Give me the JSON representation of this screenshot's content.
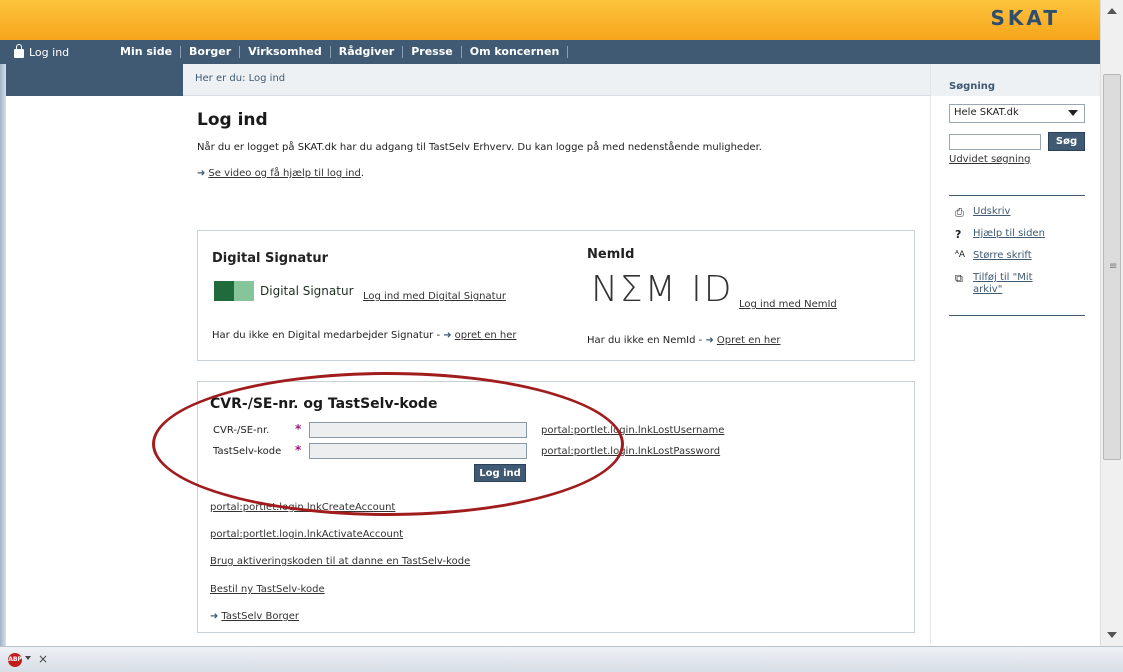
{
  "brand": {
    "logo": "SKAT",
    "accent": "#f7a51c",
    "nav_color": "#3f5a72",
    "highlight_circle": "#a11c1c"
  },
  "nav": {
    "login": "Log ind",
    "items": [
      "Min side",
      "Borger",
      "Virksomhed",
      "Rådgiver",
      "Presse",
      "Om koncernen"
    ]
  },
  "breadcrumb": "Her er du: Log ind",
  "main": {
    "title": "Log ind",
    "intro": "Når du er logget på SKAT.dk har du adgang til TastSelv Erhverv. Du kan logge på med nedenstående muligheder.",
    "video_link": "Se video og få hjælp til log ind",
    "video_suffix": "."
  },
  "digital_signatur": {
    "title": "Digital Signatur",
    "logo_text": "Digital Signatur",
    "login_link": "Log ind med Digital Signatur",
    "note": "Har du ikke en Digital medarbejder Signatur - ",
    "create_link": "opret en her"
  },
  "nemid": {
    "title": "NemId",
    "logo_text": "NΣM ID",
    "login_link": "Log ind med NemId",
    "note": "Har du ikke en NemId - ",
    "create_link": "Opret en her"
  },
  "tastselv": {
    "title": "CVR-/SE-nr. og TastSelv-kode",
    "cvr_label": "CVR-/SE-nr.",
    "code_label": "TastSelv-kode",
    "required_mark": "*",
    "cvr_value": "",
    "code_value": "",
    "lost_username": "portal:portlet.login.lnkLostUsername",
    "lost_password": "portal:portlet.login.lnkLostPassword",
    "login_button": "Log ind",
    "links": [
      "portal:portlet.login.lnkCreateAccount",
      "portal:portlet.login.lnkActivateAccount",
      "Brug aktiveringskoden til at danne en TastSelv-kode",
      "Bestil ny TastSelv-kode"
    ],
    "borger_link": "TastSelv Borger"
  },
  "sidebar": {
    "search_title": "Søgning",
    "select_value": "Hele SKAT.dk",
    "search_value": "",
    "search_button": "Søg",
    "advanced_search": "Udvidet søgning",
    "tools": [
      {
        "icon": "print-icon",
        "glyph": "⎙",
        "label": "Udskriv"
      },
      {
        "icon": "help-icon",
        "glyph": "?",
        "label": "Hjælp til siden"
      },
      {
        "icon": "text-size-icon",
        "glyph": "ᴬA",
        "label": "Større skrift"
      },
      {
        "icon": "archive-add-icon",
        "glyph": "⧉",
        "label": "Tilføj til \"Mit arkiv\""
      }
    ]
  },
  "statusbar": {
    "addon": "ABP",
    "close": "×"
  }
}
